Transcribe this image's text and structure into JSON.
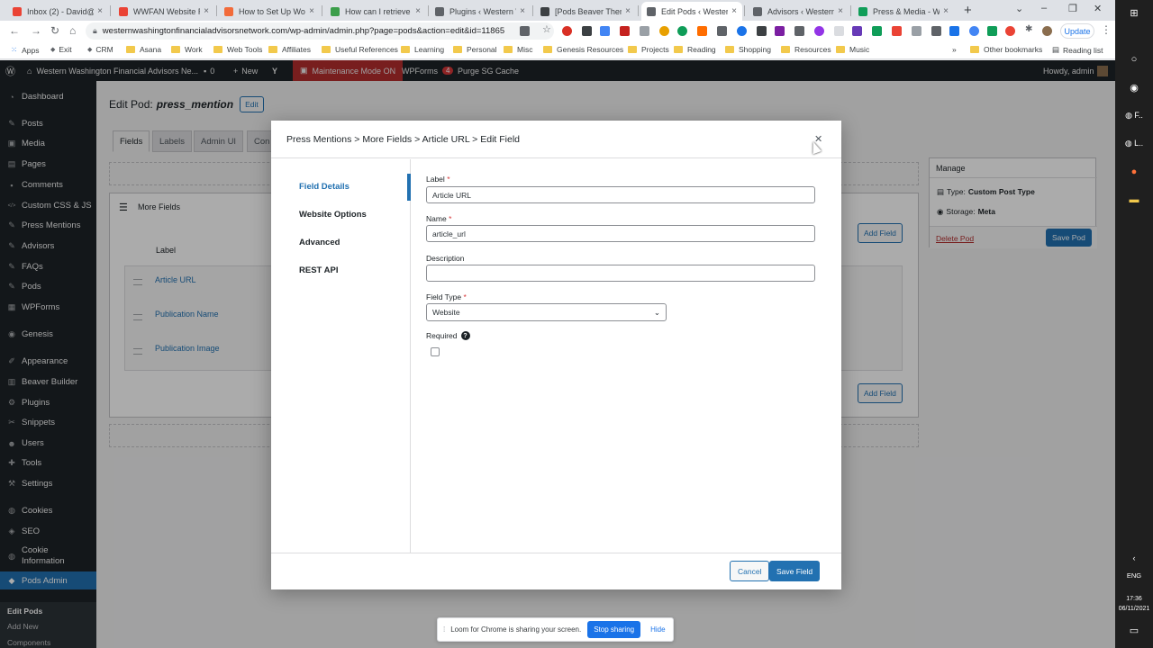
{
  "browser": {
    "tabs": [
      {
        "title": "Inbox (2) - David@p",
        "icon": "gmail-icon",
        "color": "#ea4335"
      },
      {
        "title": "WWFAN Website Re",
        "icon": "gmail-icon",
        "color": "#ea4335"
      },
      {
        "title": "How to Set Up Word",
        "icon": "tutorial-icon",
        "color": "#f26b3a"
      },
      {
        "title": "How can I retrieve th",
        "icon": "site-icon",
        "color": "#3b9e4a"
      },
      {
        "title": "Plugins ‹ Western W",
        "icon": "globe-icon",
        "color": "#5f6368"
      },
      {
        "title": "[Pods Beaver Theme",
        "icon": "wordpress-icon",
        "color": "#3c4043"
      },
      {
        "title": "Edit Pods ‹ Western W",
        "icon": "globe-icon",
        "color": "#5f6368"
      },
      {
        "title": "Advisors ‹ Western W",
        "icon": "globe-icon",
        "color": "#5f6368"
      },
      {
        "title": "Press & Media - Wes",
        "icon": "sheets-icon",
        "color": "#0f9d58"
      }
    ],
    "active_tab": 6,
    "new_tab": "+",
    "url": "westernwashingtonfinancialadvisorsnetwork.com/wp-admin/admin.php?page=pods&action=edit&id=11865",
    "update_label": "Update",
    "bookmarks": [
      {
        "label": "Apps",
        "type": "apps"
      },
      {
        "label": "Exit",
        "type": "link"
      },
      {
        "label": "CRM",
        "type": "link"
      },
      {
        "label": "Asana",
        "type": "folder"
      },
      {
        "label": "Work",
        "type": "folder"
      },
      {
        "label": "Web Tools",
        "type": "folder"
      },
      {
        "label": "Affiliates",
        "type": "folder"
      },
      {
        "label": "Useful References",
        "type": "folder"
      },
      {
        "label": "Learning",
        "type": "folder"
      },
      {
        "label": "Personal",
        "type": "folder"
      },
      {
        "label": "Misc",
        "type": "folder"
      },
      {
        "label": "Genesis Resources",
        "type": "folder"
      },
      {
        "label": "Projects",
        "type": "folder"
      },
      {
        "label": "Reading",
        "type": "folder"
      },
      {
        "label": "Shopping",
        "type": "folder"
      },
      {
        "label": "Resources",
        "type": "folder"
      },
      {
        "label": "Music",
        "type": "folder"
      }
    ],
    "bookmarks_more": "»",
    "other_bookmarks": "Other bookmarks",
    "reading_list": "Reading list"
  },
  "taskbar": {
    "lang": "ENG",
    "time": "17:36",
    "date": "06/11/2021"
  },
  "adminbar": {
    "site_name": "Western Washington Financial Advisors Ne...",
    "comments": "0",
    "new_label": "New",
    "maintenance": "Maintenance Mode ON",
    "wpforms": "WPForms",
    "wpforms_count": "4",
    "purge": "Purge SG Cache",
    "howdy": "Howdy, admin"
  },
  "sidebar": {
    "items": [
      {
        "label": "Dashboard",
        "icon": "dashboard-icon"
      },
      {
        "label": "Posts",
        "icon": "pin-icon"
      },
      {
        "label": "Media",
        "icon": "media-icon"
      },
      {
        "label": "Pages",
        "icon": "pages-icon"
      },
      {
        "label": "Comments",
        "icon": "comment-icon"
      },
      {
        "label": "Custom CSS & JS",
        "icon": "code-icon"
      },
      {
        "label": "Press Mentions",
        "icon": "pin-icon"
      },
      {
        "label": "Advisors",
        "icon": "pin-icon"
      },
      {
        "label": "FAQs",
        "icon": "pin-icon"
      },
      {
        "label": "Pods",
        "icon": "pin-icon"
      },
      {
        "label": "WPForms",
        "icon": "forms-icon"
      },
      {
        "label": "Genesis",
        "icon": "genesis-icon"
      },
      {
        "label": "Appearance",
        "icon": "brush-icon"
      },
      {
        "label": "Beaver Builder",
        "icon": "builder-icon"
      },
      {
        "label": "Plugins",
        "icon": "plugin-icon"
      },
      {
        "label": "Snippets",
        "icon": "snippet-icon"
      },
      {
        "label": "Users",
        "icon": "users-icon"
      },
      {
        "label": "Tools",
        "icon": "tools-icon"
      },
      {
        "label": "Settings",
        "icon": "settings-icon"
      },
      {
        "label": "Cookies",
        "icon": "cookie-icon"
      },
      {
        "label": "SEO",
        "icon": "seo-icon"
      },
      {
        "label": "Cookie Information",
        "icon": "cookie-icon"
      },
      {
        "label": "Pods Admin",
        "icon": "pods-icon"
      }
    ],
    "sub_items": [
      "Edit Pods",
      "Add New",
      "Components"
    ]
  },
  "page": {
    "title_prefix": "Edit Pod:",
    "pod_name": "press_mention",
    "edit_label": "Edit",
    "tabs": [
      "Fields",
      "Labels",
      "Admin UI",
      "Con"
    ],
    "group_title": "More Fields",
    "label_header": "Label",
    "fields": [
      "Article URL",
      "Publication Name",
      "Publication Image"
    ],
    "add_field": "Add Field",
    "manage": {
      "title": "Manage",
      "type_label": "Type:",
      "type_value": "Custom Post Type",
      "storage_label": "Storage:",
      "storage_value": "Meta",
      "delete": "Delete Pod",
      "save": "Save Pod"
    }
  },
  "modal": {
    "breadcrumb": "Press Mentions > More Fields > Article URL > Edit Field",
    "nav": [
      "Field Details",
      "Website Options",
      "Advanced",
      "REST API"
    ],
    "label_label": "Label",
    "label_value": "Article URL",
    "name_label": "Name",
    "name_value": "article_url",
    "description_label": "Description",
    "description_value": "",
    "type_label": "Field Type",
    "type_value": "Website",
    "required_label": "Required",
    "required_checked": false,
    "cancel": "Cancel",
    "save": "Save Field"
  },
  "loom": {
    "message": "Loom for Chrome is sharing your screen.",
    "stop": "Stop sharing",
    "hide": "Hide"
  },
  "colors": {
    "wp_blue": "#2271b1",
    "admin_dark": "#1d2327",
    "maintenance_red": "#b32d2e"
  }
}
